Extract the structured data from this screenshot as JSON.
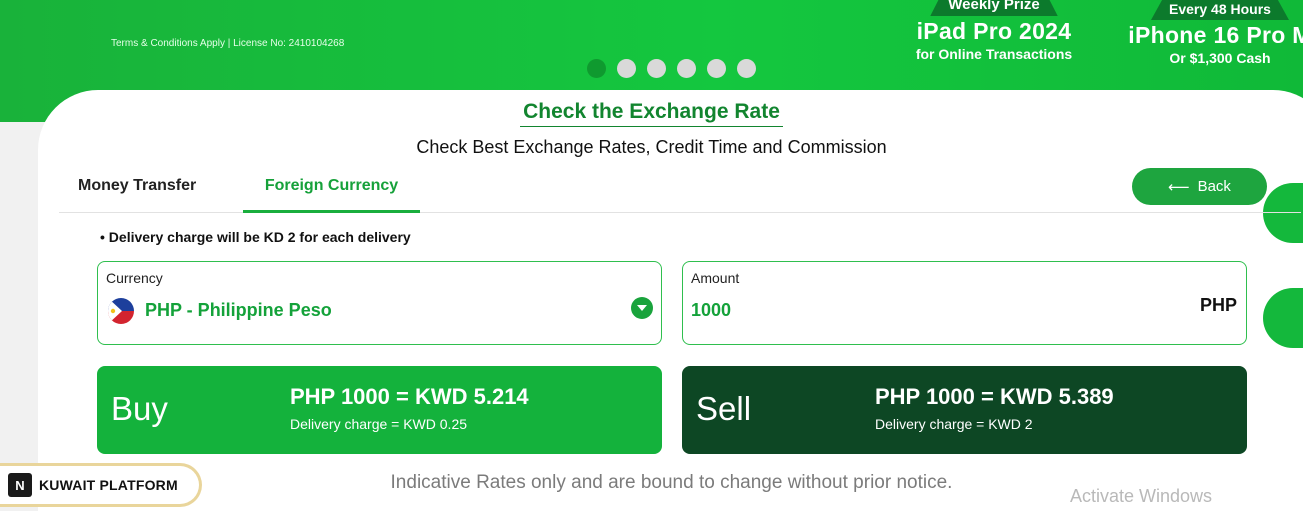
{
  "banner": {
    "terms": "Terms & Conditions Apply |  License No: 2410104268",
    "prize1": {
      "ribbon": "Weekly Prize",
      "title": "iPad Pro 2024",
      "sub": "for Online Transactions"
    },
    "prize2": {
      "ribbon": "Every 48 Hours",
      "title": "iPhone 16 Pro M",
      "sub": "Or $1,300 Cash"
    },
    "slides_total": 6,
    "active_slide": 1
  },
  "header": {
    "title": "Check the Exchange Rate",
    "subtitle": "Check Best Exchange Rates, Credit Time and Commission"
  },
  "tabs": [
    {
      "label": "Money Transfer",
      "active": false
    },
    {
      "label": "Foreign Currency",
      "active": true
    }
  ],
  "back_button": {
    "label": "Back",
    "arrow": "⟵"
  },
  "note": "• Delivery charge will be KD 2 for each delivery",
  "currency_field": {
    "label": "Currency",
    "value": "PHP - Philippine Peso",
    "flag": "philippines-flag"
  },
  "amount_field": {
    "label": "Amount",
    "value": "1000",
    "unit": "PHP"
  },
  "buy": {
    "label": "Buy",
    "rate": "PHP 1000 = KWD 5.214",
    "delivery": "Delivery charge = KWD 0.25"
  },
  "sell": {
    "label": "Sell",
    "rate": "PHP 1000 = KWD 5.389",
    "delivery": "Delivery charge = KWD 2"
  },
  "disclaimer": "Indicative Rates only and are bound to change without prior notice.",
  "watermark": "Activate Windows",
  "platform_badge": {
    "name": "KUWAIT PLATFORM",
    "logo": "N"
  },
  "colors": {
    "accent": "#14b23c",
    "dark": "#0d4724",
    "text_green": "#14a23a"
  }
}
